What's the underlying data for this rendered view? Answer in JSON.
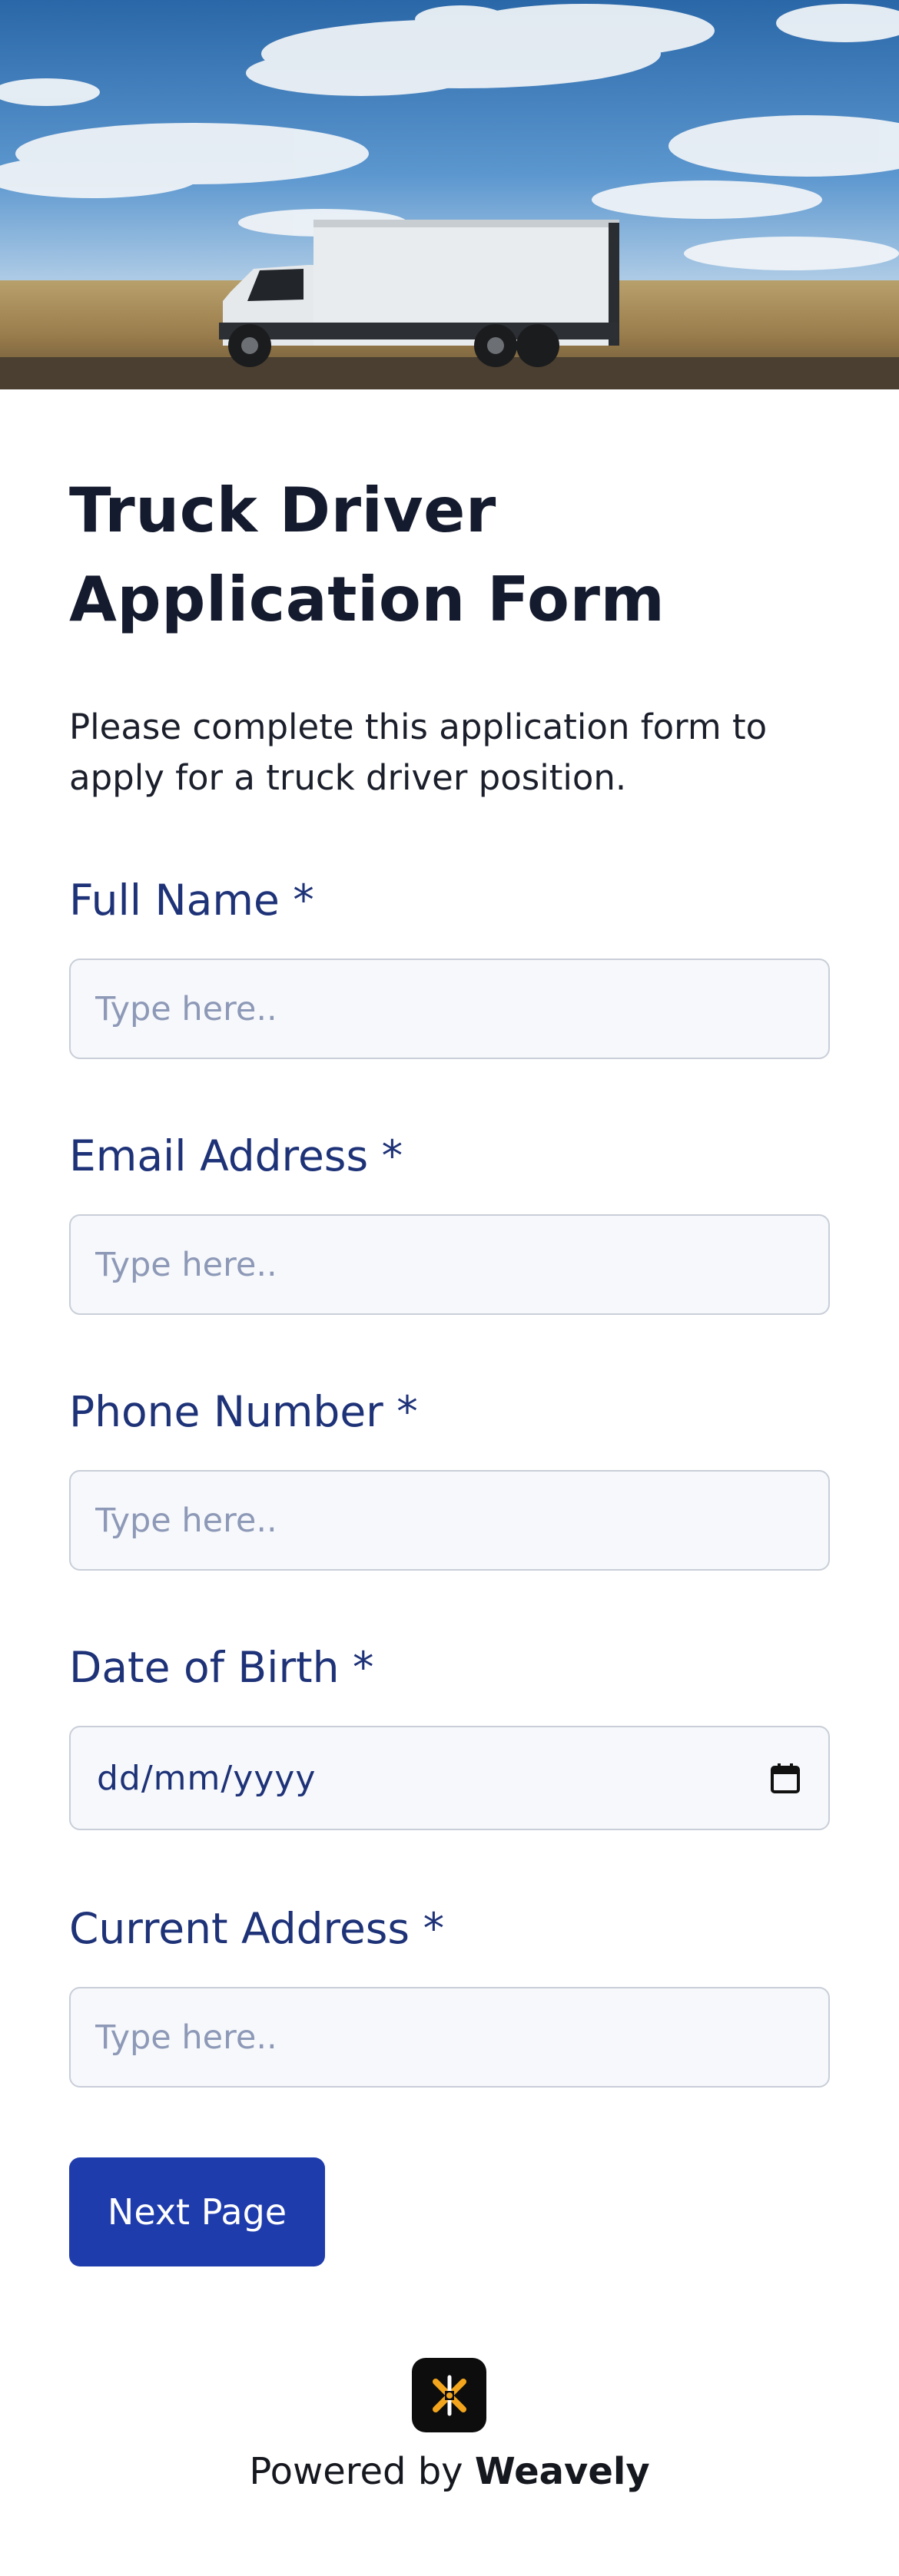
{
  "form": {
    "title": "Truck Driver Application Form",
    "description": "Please complete this application form to apply for a truck driver position."
  },
  "fields": {
    "full_name": {
      "label": "Full Name *",
      "placeholder": "Type here.."
    },
    "email": {
      "label": "Email Address *",
      "placeholder": "Type here.."
    },
    "phone": {
      "label": "Phone Number *",
      "placeholder": "Type here.."
    },
    "dob": {
      "label": "Date of Birth *",
      "value": "dd/mm/yyyy",
      "icon": "calendar-icon"
    },
    "address": {
      "label": "Current Address *",
      "placeholder": "Type here.."
    }
  },
  "actions": {
    "next_label": "Next Page"
  },
  "footer": {
    "powered_prefix": "Powered by",
    "brand": "Weavely",
    "logo_icon": "weavely-logo-icon"
  },
  "colors": {
    "title": "#151b2e",
    "label": "#1e3278",
    "button": "#1f3cad",
    "input_bg": "#f6f8fb",
    "input_border": "#c9ced8"
  },
  "hero": {
    "image": "truck-on-highway-image"
  }
}
